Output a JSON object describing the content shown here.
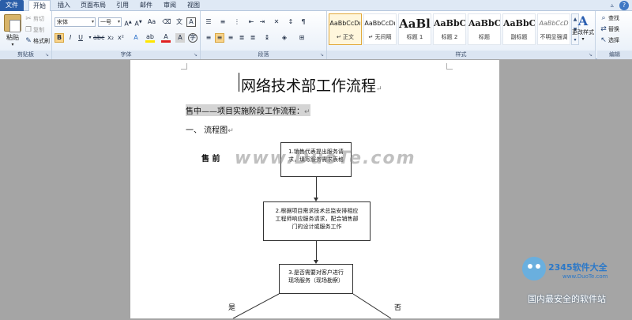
{
  "tabs": [
    {
      "label": "文件"
    },
    {
      "label": "开始"
    },
    {
      "label": "插入"
    },
    {
      "label": "页面布局"
    },
    {
      "label": "引用"
    },
    {
      "label": "邮件"
    },
    {
      "label": "审阅"
    },
    {
      "label": "视图"
    }
  ],
  "clipboard": {
    "paste": "粘贴",
    "cut": "剪切",
    "copy": "复制",
    "format_painter": "格式刷",
    "group": "剪贴板"
  },
  "font": {
    "name": "宋体",
    "size": "一号",
    "group": "字体"
  },
  "paragraph": {
    "group": "段落"
  },
  "styles": {
    "group": "样式",
    "items": [
      {
        "sample": "AaBbCcDı",
        "name": "↵ 正文"
      },
      {
        "sample": "AaBbCcDı",
        "name": "↵ 无间隔"
      },
      {
        "sample": "AaBl",
        "name": "标题 1"
      },
      {
        "sample": "AaBbC",
        "name": "标题 2"
      },
      {
        "sample": "AaBbC",
        "name": "标题"
      },
      {
        "sample": "AaBbC",
        "name": "副标题"
      },
      {
        "sample": "AaBbCcD",
        "name": "不明显强调"
      }
    ],
    "change_styles": "更改样式"
  },
  "editing": {
    "find": "查找",
    "replace": "替换",
    "select": "选择",
    "group": "编辑"
  },
  "document": {
    "title": "网络技术部工作流程",
    "subtitle": "售中——项目实施阶段工作流程：",
    "section": "一、  流程图",
    "phase_label": "售  前",
    "watermark": "www.DuoTe.com",
    "boxes": [
      {
        "line1": "1.销售代表提出服务请",
        "line2": "求，填写服务需求表格"
      },
      {
        "line1": "2.根据项目需求技术总监安排相应",
        "line2": "工程师响应服务请求，配合销售部",
        "line3": "门的设计或服务工作"
      },
      {
        "line1": "3.是否需要对客户进行",
        "line2": "现场服务（现场勘察）"
      }
    ],
    "yes": "是",
    "no": "否"
  },
  "overlay": {
    "logo": "2345软件大全",
    "url": "www.DuoTe.com",
    "slogan": "国内最安全的软件站"
  }
}
